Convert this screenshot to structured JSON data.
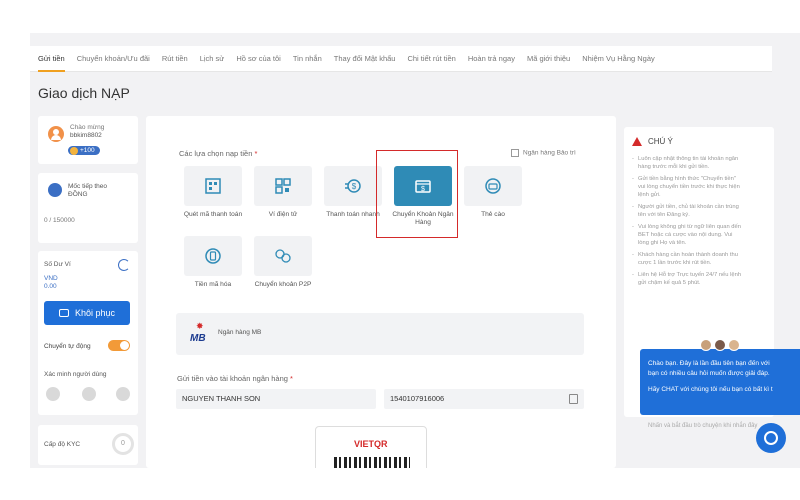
{
  "tabs": [
    {
      "label": "Gửi tiền",
      "active": true
    },
    {
      "label": "Chuyển khoản/Ưu đãi"
    },
    {
      "label": "Rút tiền"
    },
    {
      "label": "Lịch sử"
    },
    {
      "label": "Hồ sơ của tôi"
    },
    {
      "label": "Tin nhắn"
    },
    {
      "label": "Thay đổi Mật khẩu"
    },
    {
      "label": "Chi tiết rút tiền"
    },
    {
      "label": "Hoàn trả ngay"
    },
    {
      "label": "Mã giới thiệu"
    },
    {
      "label": "Nhiệm Vụ Hằng Ngày"
    }
  ],
  "page_title": "Giao dịch NẠP",
  "profile": {
    "greeting": "Chào mừng",
    "username": "bbkim8802",
    "points": "+100"
  },
  "level": {
    "label": "Mốc tiếp theo",
    "unit": "ĐỒNG",
    "progress": "0 / 150000"
  },
  "balance": {
    "label": "Số Dư Ví",
    "currency": "VND",
    "amount": "0.00",
    "restore_label": "Khôi phục"
  },
  "auto_transfer": {
    "label": "Chuyển tự động",
    "on": true
  },
  "verify": {
    "label": "Xác minh người dùng"
  },
  "kyc": {
    "label": "Cấp độ KYC",
    "value": "0"
  },
  "main": {
    "section_label": "Các lựa chọn nạp tiền",
    "required_mark": "*",
    "bank_list_link": "Ngân hàng Bảo trì",
    "options": [
      {
        "label": "Quét mã thanh toán",
        "icon": "qr-scan-icon"
      },
      {
        "label": "Ví điện tử",
        "icon": "qr-wallet-icon"
      },
      {
        "label": "Thanh toán nhanh",
        "icon": "fast-pay-icon"
      },
      {
        "label": "Chuyển Khoản Ngân Hàng",
        "icon": "bank-transfer-icon",
        "selected": true
      },
      {
        "label": "Thẻ cào",
        "icon": "scratch-card-icon"
      },
      {
        "label": "Tiền mã hóa",
        "icon": "crypto-icon"
      },
      {
        "label": "Chuyển khoản P2P",
        "icon": "p2p-icon"
      }
    ],
    "bank": {
      "logo_text": "MB",
      "name": "Ngân hàng MB"
    },
    "account_label": "Gửi tiền vào tài khoản ngân hàng",
    "account_name": "NGUYEN THANH SON",
    "account_number": "1540107916006",
    "qr_brand": "VIETQR"
  },
  "notice": {
    "title": "CHÚ Ý",
    "items": [
      "Luôn cập nhật thông tin tài khoản ngân hàng trước mỗi khi gửi tiền.",
      "Gửi tiền bằng hình thức \"Chuyển tiền\" vui lòng chuyển tiền trước khi thực hiện lệnh gửi.",
      "Người gửi tiền, chủ tài khoản cần trùng tên với tên Đăng ký.",
      "Vui lòng không ghi từ ngữ liên quan đến BET hoặc cá cược vào nội dung. Vui lòng ghi Họ và tên.",
      "Khách hàng cần hoàn thành doanh thu cược 1 lần trước khi rút tiền.",
      "Liên hệ Hỗ trợ Trực tuyến 24/7 nếu lệnh gửi chậm kế quả 5 phút."
    ]
  },
  "chat": {
    "line1": "Chào bạn. Đây là lần đầu tiên bạn đến với",
    "line2": "bạn có nhiều câu hỏi muốn được giải đáp.",
    "line3": "Hãy CHAT với chúng tôi nếu bạn có bất kì t",
    "input_placeholder": "Nhấn và bắt đầu trò chuyện khi nhắn đây"
  },
  "colors": {
    "accent": "#1f6fd8",
    "orange": "#f0a020",
    "selected": "#2f8bb6",
    "highlight": "#d42a2a"
  }
}
